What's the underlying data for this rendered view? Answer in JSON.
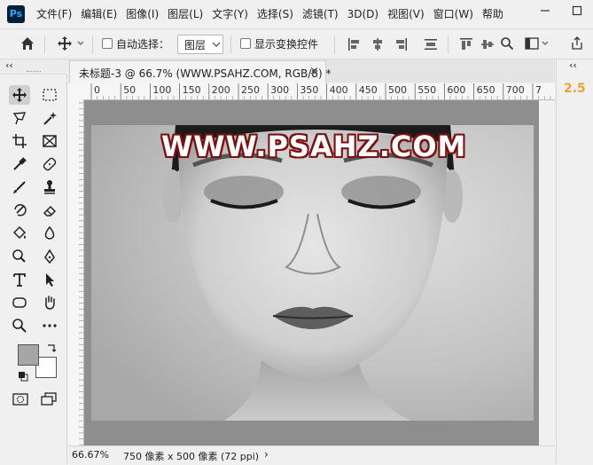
{
  "app": {
    "logo_text": "Ps"
  },
  "menu": [
    "文件(F)",
    "编辑(E)",
    "图像(I)",
    "图层(L)",
    "文字(Y)",
    "选择(S)",
    "滤镜(T)",
    "3D(D)",
    "视图(V)",
    "窗口(W)",
    "帮助"
  ],
  "window_controls": {
    "minimize": "—",
    "maximize": "☐"
  },
  "options_bar": {
    "home_icon": "home-icon",
    "move_icon": "move-icon",
    "auto_select_label": "自动选择：",
    "auto_select_checked": false,
    "layer_dropdown_value": "图层",
    "show_transform_label": "显示变换控件",
    "show_transform_checked": false
  },
  "panel_collapse_glyph": "‹‹",
  "document": {
    "tab_title": "未标题-3 @ 66.7% (WWW.PSAHZ.COM, RGB/8) *",
    "close_glyph": "×",
    "watermark_text": "WWW.PSAHZ.COM"
  },
  "ruler": {
    "top_ticks": [
      "0",
      "50",
      "100",
      "150",
      "200",
      "250",
      "300",
      "350",
      "400",
      "450",
      "500",
      "550",
      "600",
      "650",
      "700",
      "7"
    ]
  },
  "status": {
    "zoom": "66.67%",
    "info": "750 像素 x 500 像素 (72 ppi)",
    "arrow": "›"
  },
  "right_panel": {
    "value": "2.5"
  },
  "colors": {
    "foreground": "#a6a6a6",
    "background": "#ffffff",
    "accent": "#e8a33a"
  }
}
